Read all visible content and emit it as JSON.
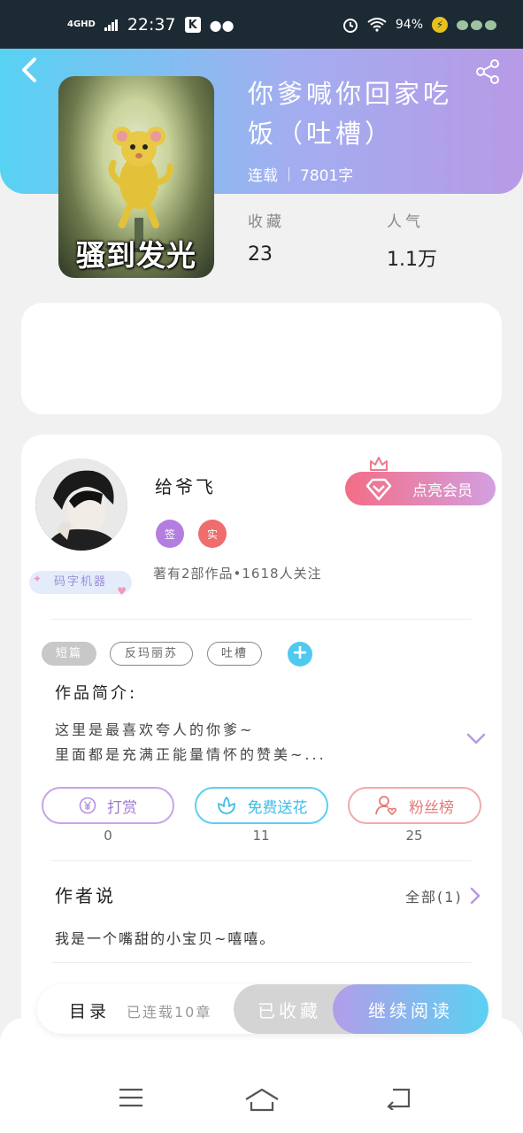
{
  "status_bar": {
    "network": "4GHD",
    "time": "22:37",
    "app_chip": "K",
    "battery": "94%"
  },
  "header": {
    "back_icon": "chevron-left-icon",
    "share_icon": "share-icon"
  },
  "book": {
    "cover_caption": "骚到发光",
    "title_line1": "你爹喊你回家吃",
    "title_line2": "饭（吐槽）",
    "status": "连载",
    "word_count": "7801字",
    "stats": [
      {
        "label": "收藏",
        "value": "23"
      },
      {
        "label": "人气",
        "value": "1.1万"
      }
    ]
  },
  "author": {
    "tag": "码字机器",
    "name": "给爷飞",
    "badges": [
      "签",
      "实"
    ],
    "works_summary": "著有2部作品•1618人关注",
    "vip_label": "点亮会员"
  },
  "tags": [
    "短篇",
    "反玛丽苏",
    "吐槽"
  ],
  "intro": {
    "title": "作品简介:",
    "line1": "这里是最喜欢夸人的你爹~",
    "line2": "里面都是充满正能量情怀的赞美~..."
  },
  "actions": [
    {
      "label": "打赏",
      "count": "0",
      "icon": "yuan-coin-icon"
    },
    {
      "label": "免费送花",
      "count": "11",
      "icon": "flower-icon"
    },
    {
      "label": "粉丝榜",
      "count": "25",
      "icon": "fans-icon"
    }
  ],
  "author_says": {
    "title": "作者说",
    "all_label": "全部(1)",
    "text": "我是一个嘴甜的小宝贝~嘻嘻。"
  },
  "bottom_bar": {
    "toc_label": "目录",
    "serial_info": "已连载10章",
    "collected_label": "已收藏",
    "continue_label": "继续阅读"
  },
  "colors": {
    "header_gradient_start": "#57d2f2",
    "header_gradient_end": "#b89ae6",
    "accent_blue": "#4fc9ef",
    "vip_pink": "#f36d86"
  }
}
